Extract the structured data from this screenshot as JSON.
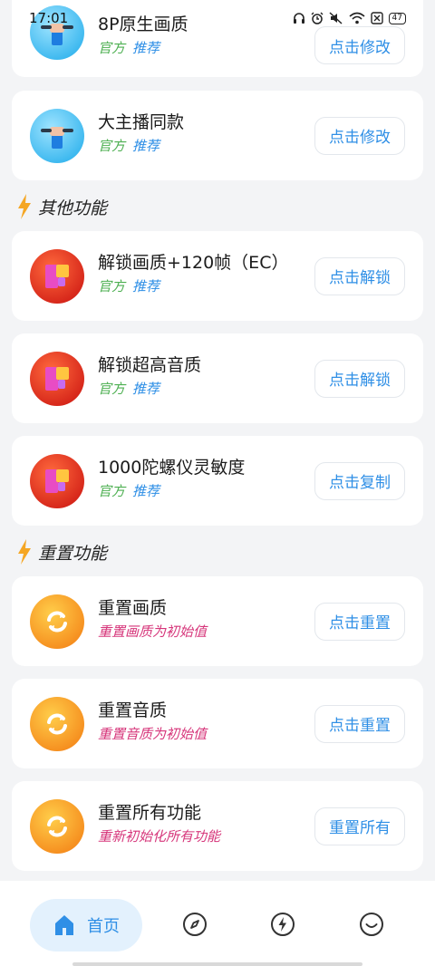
{
  "status_bar": {
    "time": "17:01",
    "battery": "47"
  },
  "cards_top": [
    {
      "title": "8P原生画质",
      "tag1": "官方",
      "tag2": "推荐",
      "button": "点击修改"
    },
    {
      "title": "大主播同款",
      "tag1": "官方",
      "tag2": "推荐",
      "button": "点击修改"
    }
  ],
  "sections": {
    "other": "其他功能",
    "reset": "重置功能"
  },
  "cards_other": [
    {
      "title": "解锁画质+120帧（EC）",
      "tag1": "官方",
      "tag2": "推荐",
      "button": "点击解锁"
    },
    {
      "title": "解锁超高音质",
      "tag1": "官方",
      "tag2": "推荐",
      "button": "点击解锁"
    },
    {
      "title": "1000陀螺仪灵敏度",
      "tag1": "官方",
      "tag2": "推荐",
      "button": "点击复制"
    }
  ],
  "cards_reset": [
    {
      "title": "重置画质",
      "subtitle": "重置画质为初始值",
      "button": "点击重置"
    },
    {
      "title": "重置音质",
      "subtitle": "重置音质为初始值",
      "button": "点击重置"
    },
    {
      "title": "重置所有功能",
      "subtitle": "重新初始化所有功能",
      "button": "重置所有"
    }
  ],
  "nav": {
    "home_label": "首页"
  },
  "colors": {
    "accent": "#2f8fe6",
    "tag_green": "#4caf50",
    "tag_pink": "#d6357a",
    "lightning": "#f5a623"
  },
  "icons": {
    "card_top": "wrench-hand-icon",
    "card_other": "puzzle-icon",
    "card_reset": "refresh-icon",
    "section": "lightning-icon",
    "nav": [
      "home-icon",
      "compass-icon",
      "lightning-circle-icon",
      "smile-icon"
    ]
  }
}
